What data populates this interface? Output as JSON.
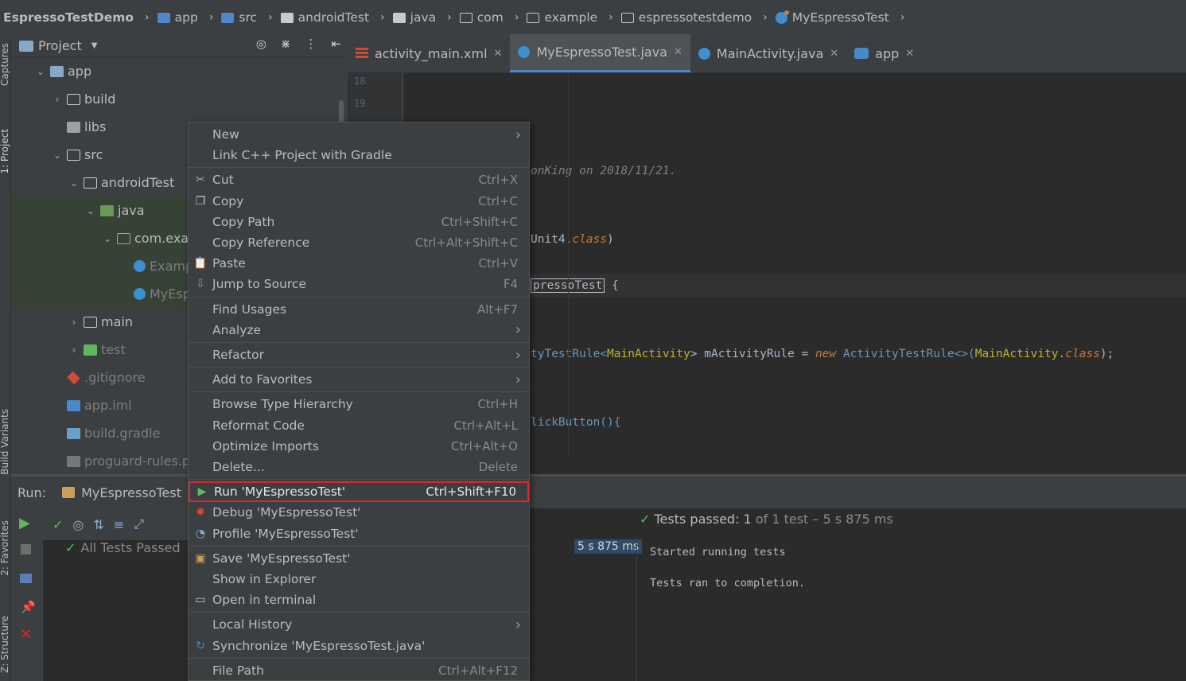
{
  "breadcrumb": {
    "items": [
      "EspressoTestDemo",
      "app",
      "src",
      "androidTest",
      "java",
      "com",
      "example",
      "espressotestdemo",
      "MyEspressoTest"
    ]
  },
  "sidebar_left": {
    "tabs": [
      "Captures",
      "1: Project",
      "Build Variants",
      "2: Favorites",
      "Z: Structure"
    ]
  },
  "project": {
    "title": "Project",
    "tree": [
      {
        "label": "app",
        "depth": 1,
        "arrow": "down",
        "icon": "module"
      },
      {
        "label": "build",
        "depth": 2,
        "arrow": "right",
        "icon": "folder-outline"
      },
      {
        "label": "libs",
        "depth": 2,
        "arrow": "",
        "icon": "folder"
      },
      {
        "label": "src",
        "depth": 2,
        "arrow": "down",
        "icon": "folder-outline"
      },
      {
        "label": "androidTest",
        "depth": 3,
        "arrow": "down",
        "icon": "folder-outline"
      },
      {
        "label": "java",
        "depth": 4,
        "arrow": "down",
        "icon": "java-folder"
      },
      {
        "label": "com.exan",
        "depth": 5,
        "arrow": "down",
        "icon": "package"
      },
      {
        "label": "Examp",
        "depth": 6,
        "arrow": "",
        "icon": "class",
        "dim": true
      },
      {
        "label": "MyEsp",
        "depth": 6,
        "arrow": "",
        "icon": "class",
        "dim": true
      },
      {
        "label": "main",
        "depth": 3,
        "arrow": "right",
        "icon": "folder-outline"
      },
      {
        "label": "test",
        "depth": 3,
        "arrow": "right",
        "icon": "test-folder",
        "dim": true
      },
      {
        "label": ".gitignore",
        "depth": 2,
        "arrow": "",
        "icon": "git",
        "dim": true
      },
      {
        "label": "app.iml",
        "depth": 2,
        "arrow": "",
        "icon": "iml",
        "dim": true
      },
      {
        "label": "build.gradle",
        "depth": 2,
        "arrow": "",
        "icon": "gradle",
        "dim": true
      },
      {
        "label": "proguard-rules.pro",
        "depth": 2,
        "arrow": "",
        "icon": "file",
        "dim": true
      }
    ]
  },
  "editor": {
    "tabs": [
      {
        "label": "activity_main.xml",
        "active": false
      },
      {
        "label": "MyEspressoTest.java",
        "active": true
      },
      {
        "label": "MainActivity.java",
        "active": false
      },
      {
        "label": "app",
        "active": false
      }
    ],
    "line_numbers": [
      "18",
      "19"
    ],
    "code": {
      "comment": "onKing on 2018/11/21.",
      "runwith": "Unit4.",
      "runwith_kw": "class",
      "runwith_end": ")",
      "class_name": "pressoTest",
      "class_brace": " {",
      "rule_type": "tyTestRule<",
      "rule_generic": "MainActivity",
      "rule_mid": "> mActivityRule = ",
      "rule_new": "new",
      "rule_ctor": " ActivityTestRule<>(",
      "rule_arg": "MainActivity",
      "rule_dot": ".",
      "rule_cls": "class",
      "rule_end": ");",
      "method": "lickButton(){"
    }
  },
  "run": {
    "label": "Run:",
    "config": "MyEspressoTest",
    "all_tests": "All Tests Passed",
    "duration": "5 s 875 ms",
    "tests_passed_prefix": "Tests passed:",
    "tests_passed_count": "1",
    "tests_passed_suffix": "of 1 test – 5 s 875 ms",
    "console_lines": [
      "Started running tests",
      "Tests ran to completion."
    ]
  },
  "context_menu": {
    "items": [
      {
        "label": "New",
        "shortcut": "",
        "submenu": true,
        "icon": ""
      },
      {
        "label": "Link C++ Project with Gradle",
        "shortcut": "",
        "submenu": false,
        "icon": ""
      },
      {
        "sep": true
      },
      {
        "label": "Cut",
        "shortcut": "Ctrl+X",
        "icon": "scissors"
      },
      {
        "label": "Copy",
        "shortcut": "Ctrl+C",
        "icon": "copy"
      },
      {
        "label": "Copy Path",
        "shortcut": "Ctrl+Shift+C",
        "icon": ""
      },
      {
        "label": "Copy Reference",
        "shortcut": "Ctrl+Alt+Shift+C",
        "icon": ""
      },
      {
        "label": "Paste",
        "shortcut": "Ctrl+V",
        "icon": "clipboard"
      },
      {
        "label": "Jump to Source",
        "shortcut": "F4",
        "icon": "jump"
      },
      {
        "sep": true
      },
      {
        "label": "Find Usages",
        "shortcut": "Alt+F7",
        "icon": ""
      },
      {
        "label": "Analyze",
        "shortcut": "",
        "submenu": true,
        "icon": ""
      },
      {
        "sep": true
      },
      {
        "label": "Refactor",
        "shortcut": "",
        "submenu": true,
        "icon": ""
      },
      {
        "sep": true
      },
      {
        "label": "Add to Favorites",
        "shortcut": "",
        "submenu": true,
        "icon": ""
      },
      {
        "sep": true
      },
      {
        "label": "Browse Type Hierarchy",
        "shortcut": "Ctrl+H",
        "icon": ""
      },
      {
        "label": "Reformat Code",
        "shortcut": "Ctrl+Alt+L",
        "icon": ""
      },
      {
        "label": "Optimize Imports",
        "shortcut": "Ctrl+Alt+O",
        "icon": ""
      },
      {
        "label": "Delete...",
        "shortcut": "Delete",
        "icon": ""
      },
      {
        "sep": true
      },
      {
        "label": "Run 'MyEspressoTest'",
        "shortcut": "Ctrl+Shift+F10",
        "icon": "run",
        "highlight": true
      },
      {
        "label": "Debug 'MyEspressoTest'",
        "shortcut": "",
        "icon": "debug"
      },
      {
        "label": "Profile 'MyEspressoTest'",
        "shortcut": "",
        "icon": "profile"
      },
      {
        "sep": true
      },
      {
        "label": "Save 'MyEspressoTest'",
        "shortcut": "",
        "icon": "save"
      },
      {
        "label": "Show in Explorer",
        "shortcut": "",
        "icon": ""
      },
      {
        "label": "Open in terminal",
        "shortcut": "",
        "icon": "terminal"
      },
      {
        "sep": true
      },
      {
        "label": "Local History",
        "shortcut": "",
        "submenu": true,
        "icon": ""
      },
      {
        "label": "Synchronize 'MyEspressoTest.java'",
        "shortcut": "",
        "icon": "sync"
      },
      {
        "sep": true
      },
      {
        "label": "File Path",
        "shortcut": "Ctrl+Alt+F12",
        "icon": ""
      }
    ]
  },
  "colors": {
    "highlight_border": "#d9272e",
    "accent": "#4a88c7",
    "success": "#5fb760"
  }
}
